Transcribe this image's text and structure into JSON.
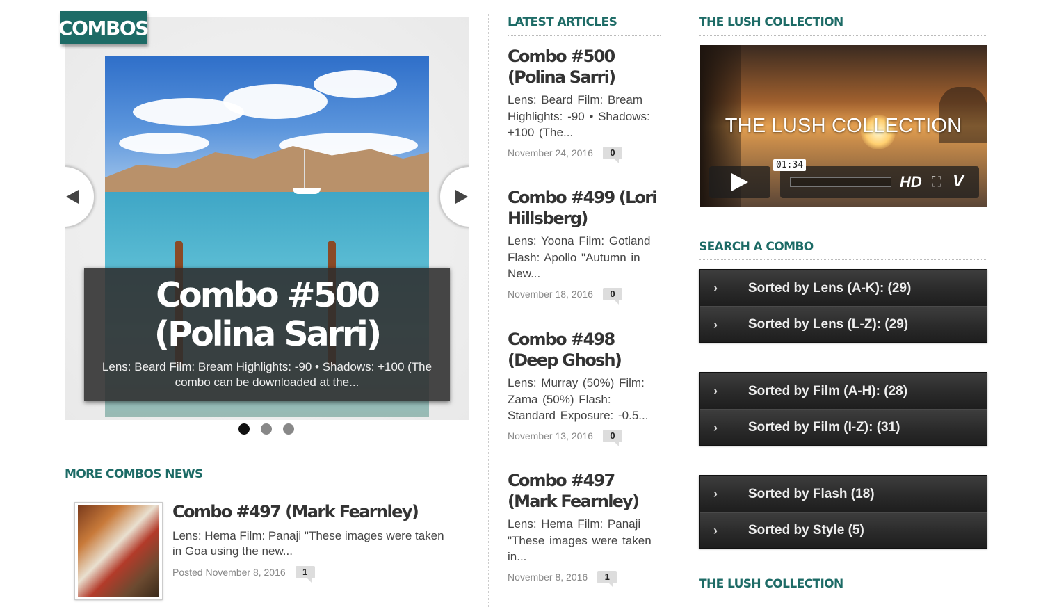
{
  "left": {
    "section_tag": "COMBOS",
    "slider": {
      "caption_title": "Combo #500 (Polina Sarri)",
      "caption_text": "Lens: Beard Film: Bream Highlights: -90 • Shadows: +100 (The combo can be downloaded at the...",
      "dots": [
        "1",
        "2",
        "3"
      ],
      "active_dot": 0
    },
    "more_news": {
      "title": "MORE COMBOS NEWS",
      "item": {
        "title": "Combo #497 (Mark Fearnley)",
        "text": "Lens: Hema Film: Panaji \"These images were taken in Goa using the new...",
        "posted": "Posted November 8, 2016",
        "comments": "1"
      }
    }
  },
  "middle": {
    "title": "LATEST ARTICLES",
    "articles": [
      {
        "title": "Combo #500 (Polina Sarri)",
        "text": "Lens: Beard Film: Bream Highlights: -90 • Shadows: +100 (The...",
        "date": "November 24, 2016",
        "comments": "0"
      },
      {
        "title": "Combo #499 (Lori Hillsberg)",
        "text": "Lens: Yoona Film: Gotland Flash: Apollo \"Autumn in New...",
        "date": "November 18, 2016",
        "comments": "0"
      },
      {
        "title": "Combo #498 (Deep Ghosh)",
        "text": "Lens: Murray (50%) Film: Zama (50%) Flash: Standard Exposure: -0.5...",
        "date": "November 13, 2016",
        "comments": "0"
      },
      {
        "title": "Combo #497 (Mark Fearnley)",
        "text": "Lens: Hema Film: Panaji \"These images were taken in...",
        "date": "November 8, 2016",
        "comments": "1"
      }
    ]
  },
  "right": {
    "lush_title": "THE LUSH COLLECTION",
    "video": {
      "overlay_title": "THE LUSH COLLECTION",
      "time": "01:34",
      "hd_label": "HD",
      "vimeo_label": "V"
    },
    "search_title": "SEARCH A COMBO",
    "sort_groups": [
      [
        "Sorted by Lens (A-K): (29)",
        "Sorted by Lens (L-Z): (29)"
      ],
      [
        "Sorted by Film (A-H): (28)",
        "Sorted by Film (I-Z): (31)"
      ],
      [
        "Sorted by Flash (18)",
        "Sorted by Style (5)"
      ]
    ],
    "lush_title_2": "THE LUSH COLLECTION"
  },
  "colors": {
    "accent": "#1d6b66",
    "caption_bg": "#2d2d2d",
    "sort_bg": "#2a2a2a"
  }
}
